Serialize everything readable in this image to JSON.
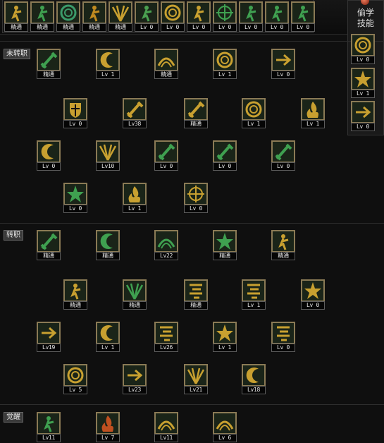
{
  "window": {
    "title": ""
  },
  "side_panel": {
    "title_line1": "偷学",
    "title_line2": "技能"
  },
  "sections": [
    {
      "label": "未转职"
    },
    {
      "label": "转职"
    },
    {
      "label": "觉醒"
    }
  ],
  "top_row": [
    {
      "name": "top-skill-1",
      "icon": "crouch-figure-icon",
      "level": "精通",
      "color": "#c8a030"
    },
    {
      "name": "top-skill-2",
      "icon": "runner-icon",
      "level": "精通",
      "color": "#3fa050"
    },
    {
      "name": "top-skill-3",
      "icon": "spiral-aura-icon",
      "level": "精通",
      "color": "#3b9a6a"
    },
    {
      "name": "top-skill-4",
      "icon": "flame-figure-icon",
      "level": "精通",
      "color": "#c08a20"
    },
    {
      "name": "top-skill-5",
      "icon": "wings-icon",
      "level": "精通",
      "color": "#c8a030"
    },
    {
      "name": "top-skill-6",
      "icon": "figure-green-icon",
      "level": "Lv 0",
      "color": "#4aa050"
    },
    {
      "name": "top-skill-7",
      "icon": "target-ring-icon",
      "level": "Lv 0",
      "color": "#c8a030"
    },
    {
      "name": "top-skill-8",
      "icon": "warrior-gold-icon",
      "level": "Lv 0",
      "color": "#c8a030"
    },
    {
      "name": "top-skill-9",
      "icon": "crosshair-icon",
      "level": "Lv 0",
      "color": "#3fa050"
    },
    {
      "name": "top-skill-10",
      "icon": "figure-kneel-icon",
      "level": "Lv 0",
      "color": "#3fa050"
    },
    {
      "name": "top-skill-11",
      "icon": "figure-burst-icon",
      "level": "Lv 0",
      "color": "#3fa050"
    },
    {
      "name": "top-skill-12",
      "icon": "figure-gear-icon",
      "level": "Lv 0",
      "color": "#3fa050"
    }
  ],
  "side_skills": [
    {
      "name": "side-skill-1",
      "icon": "vortex-icon",
      "level": "Lv 0",
      "color": "#c8a030"
    },
    {
      "name": "side-skill-2",
      "icon": "fist-burst-icon",
      "level": "Lv 1",
      "color": "#c8a030"
    },
    {
      "name": "side-skill-3",
      "icon": "chevron-slash-icon",
      "level": "Lv 0",
      "color": "#c8a030"
    }
  ],
  "skills_base": [
    {
      "name": "skill-sword-rain",
      "icon": "sword-rain-icon",
      "level": "精通",
      "color": "#3fa050"
    },
    {
      "name": "skill-upper-slash",
      "icon": "slash-arc-icon",
      "level": "Lv 1",
      "color": "#c8a030"
    },
    {
      "name": "skill-wave-slash",
      "icon": "wave-slash-icon",
      "level": "精通",
      "color": "#c8a030"
    },
    {
      "name": "skill-ring-wave",
      "icon": "ring-wave-icon",
      "level": "Lv 1",
      "color": "#c8a030"
    },
    {
      "name": "skill-thrust",
      "icon": "arrow-thrust-icon",
      "level": "Lv 0",
      "color": "#c8a030"
    },
    {
      "name": "skill-guard",
      "icon": "shield-icon",
      "level": "Lv 0",
      "color": "#c8a030"
    },
    {
      "name": "skill-blade-fan",
      "icon": "blade-fan-icon",
      "level": "Lv38",
      "color": "#c8a030"
    },
    {
      "name": "skill-triple-blade",
      "icon": "triple-blade-icon",
      "level": "精通",
      "color": "#c8a030"
    },
    {
      "name": "skill-whirl",
      "icon": "whirl-icon",
      "level": "Lv 1",
      "color": "#c8a030"
    },
    {
      "name": "skill-flame-wave",
      "icon": "flame-wave-icon",
      "level": "Lv 1",
      "color": "#c8a030"
    },
    {
      "name": "skill-moon-slash",
      "icon": "crescent-icon",
      "level": "Lv 0",
      "color": "#c8a030"
    },
    {
      "name": "skill-triple-claw",
      "icon": "claw-icon",
      "level": "Lv10",
      "color": "#c8a030"
    },
    {
      "name": "skill-green-sword-1",
      "icon": "green-sword-icon",
      "level": "Lv 0",
      "color": "#3fa050"
    },
    {
      "name": "skill-green-sword-2",
      "icon": "green-blade-icon",
      "level": "Lv 0",
      "color": "#3fa050"
    },
    {
      "name": "skill-green-sword-3",
      "icon": "green-broadsword-icon",
      "level": "Lv 0",
      "color": "#3fa050"
    },
    {
      "name": "skill-burst",
      "icon": "starburst-icon",
      "level": "Lv 0",
      "color": "#3fa050"
    },
    {
      "name": "skill-rising-flame",
      "icon": "rising-flame-icon",
      "level": "Lv 1",
      "color": "#c8a030"
    },
    {
      "name": "skill-cross-strike",
      "icon": "cross-strike-icon",
      "level": "Lv 0",
      "color": "#c8a030"
    }
  ],
  "skills_job": [
    {
      "name": "skill-green-lightning",
      "icon": "lightning-icon",
      "level": "精通",
      "color": "#3fa050"
    },
    {
      "name": "skill-hook-slash",
      "icon": "hook-icon",
      "level": "精通",
      "color": "#3fa050"
    },
    {
      "name": "skill-multi-stab",
      "icon": "multi-stab-icon",
      "level": "Lv22",
      "color": "#3fa050"
    },
    {
      "name": "skill-thorn-burst",
      "icon": "thorn-icon",
      "level": "精通",
      "color": "#3fa050"
    },
    {
      "name": "skill-kneel-strike",
      "icon": "kneel-figure-icon",
      "level": "精通",
      "color": "#c8a030"
    },
    {
      "name": "skill-leap-cut",
      "icon": "leap-figure-icon",
      "level": "精通",
      "color": "#c8a030"
    },
    {
      "name": "skill-green-fan",
      "icon": "green-fan-icon",
      "level": "精通",
      "color": "#3fa050"
    },
    {
      "name": "skill-flow-glyph",
      "icon": "flow-glyph-icon",
      "level": "精通",
      "color": "#c8a030"
    },
    {
      "name": "skill-flow-slash",
      "icon": "flow-slash-icon",
      "level": "Lv 1",
      "color": "#c8a030"
    },
    {
      "name": "skill-sword-star",
      "icon": "sword-star-icon",
      "level": "Lv 0",
      "color": "#c8a030"
    },
    {
      "name": "skill-upward-arrow",
      "icon": "up-arrow-icon",
      "level": "Lv19",
      "color": "#c8a030"
    },
    {
      "name": "skill-flow-moon",
      "icon": "flow-moon-icon",
      "level": "Lv 1",
      "color": "#c8a030"
    },
    {
      "name": "skill-flow-dash",
      "icon": "flow-dash-icon",
      "level": "Lv26",
      "color": "#c8a030"
    },
    {
      "name": "skill-flow-burst",
      "icon": "flow-burst-icon",
      "level": "Lv 1",
      "color": "#c8a030"
    },
    {
      "name": "skill-flow-lines",
      "icon": "flow-lines-icon",
      "level": "Lv 0",
      "color": "#c8a030"
    },
    {
      "name": "skill-spiral-cut",
      "icon": "spiral-cut-icon",
      "level": "Lv 5",
      "color": "#c8a030"
    },
    {
      "name": "skill-arc-arrow",
      "icon": "arc-arrow-icon",
      "level": "Lv23",
      "color": "#c8a030"
    },
    {
      "name": "skill-beast-fang",
      "icon": "fang-icon",
      "level": "Lv21",
      "color": "#c8a030"
    },
    {
      "name": "skill-e-swirl",
      "icon": "e-swirl-icon",
      "level": "Lv18",
      "color": "#c8a030"
    }
  ],
  "skills_awaken": [
    {
      "name": "skill-green-awaken",
      "icon": "green-figure-icon",
      "level": "Lv11",
      "color": "#3fa050"
    },
    {
      "name": "skill-fire-awaken",
      "icon": "fire-demon-icon",
      "level": "Lv 7",
      "color": "#c05020"
    },
    {
      "name": "skill-wind-awaken",
      "icon": "wind-wave-icon",
      "level": "Lv11",
      "color": "#c8a030"
    },
    {
      "name": "skill-storm-awaken",
      "icon": "storm-icon",
      "level": "Lv 6",
      "color": "#c8a030"
    }
  ]
}
